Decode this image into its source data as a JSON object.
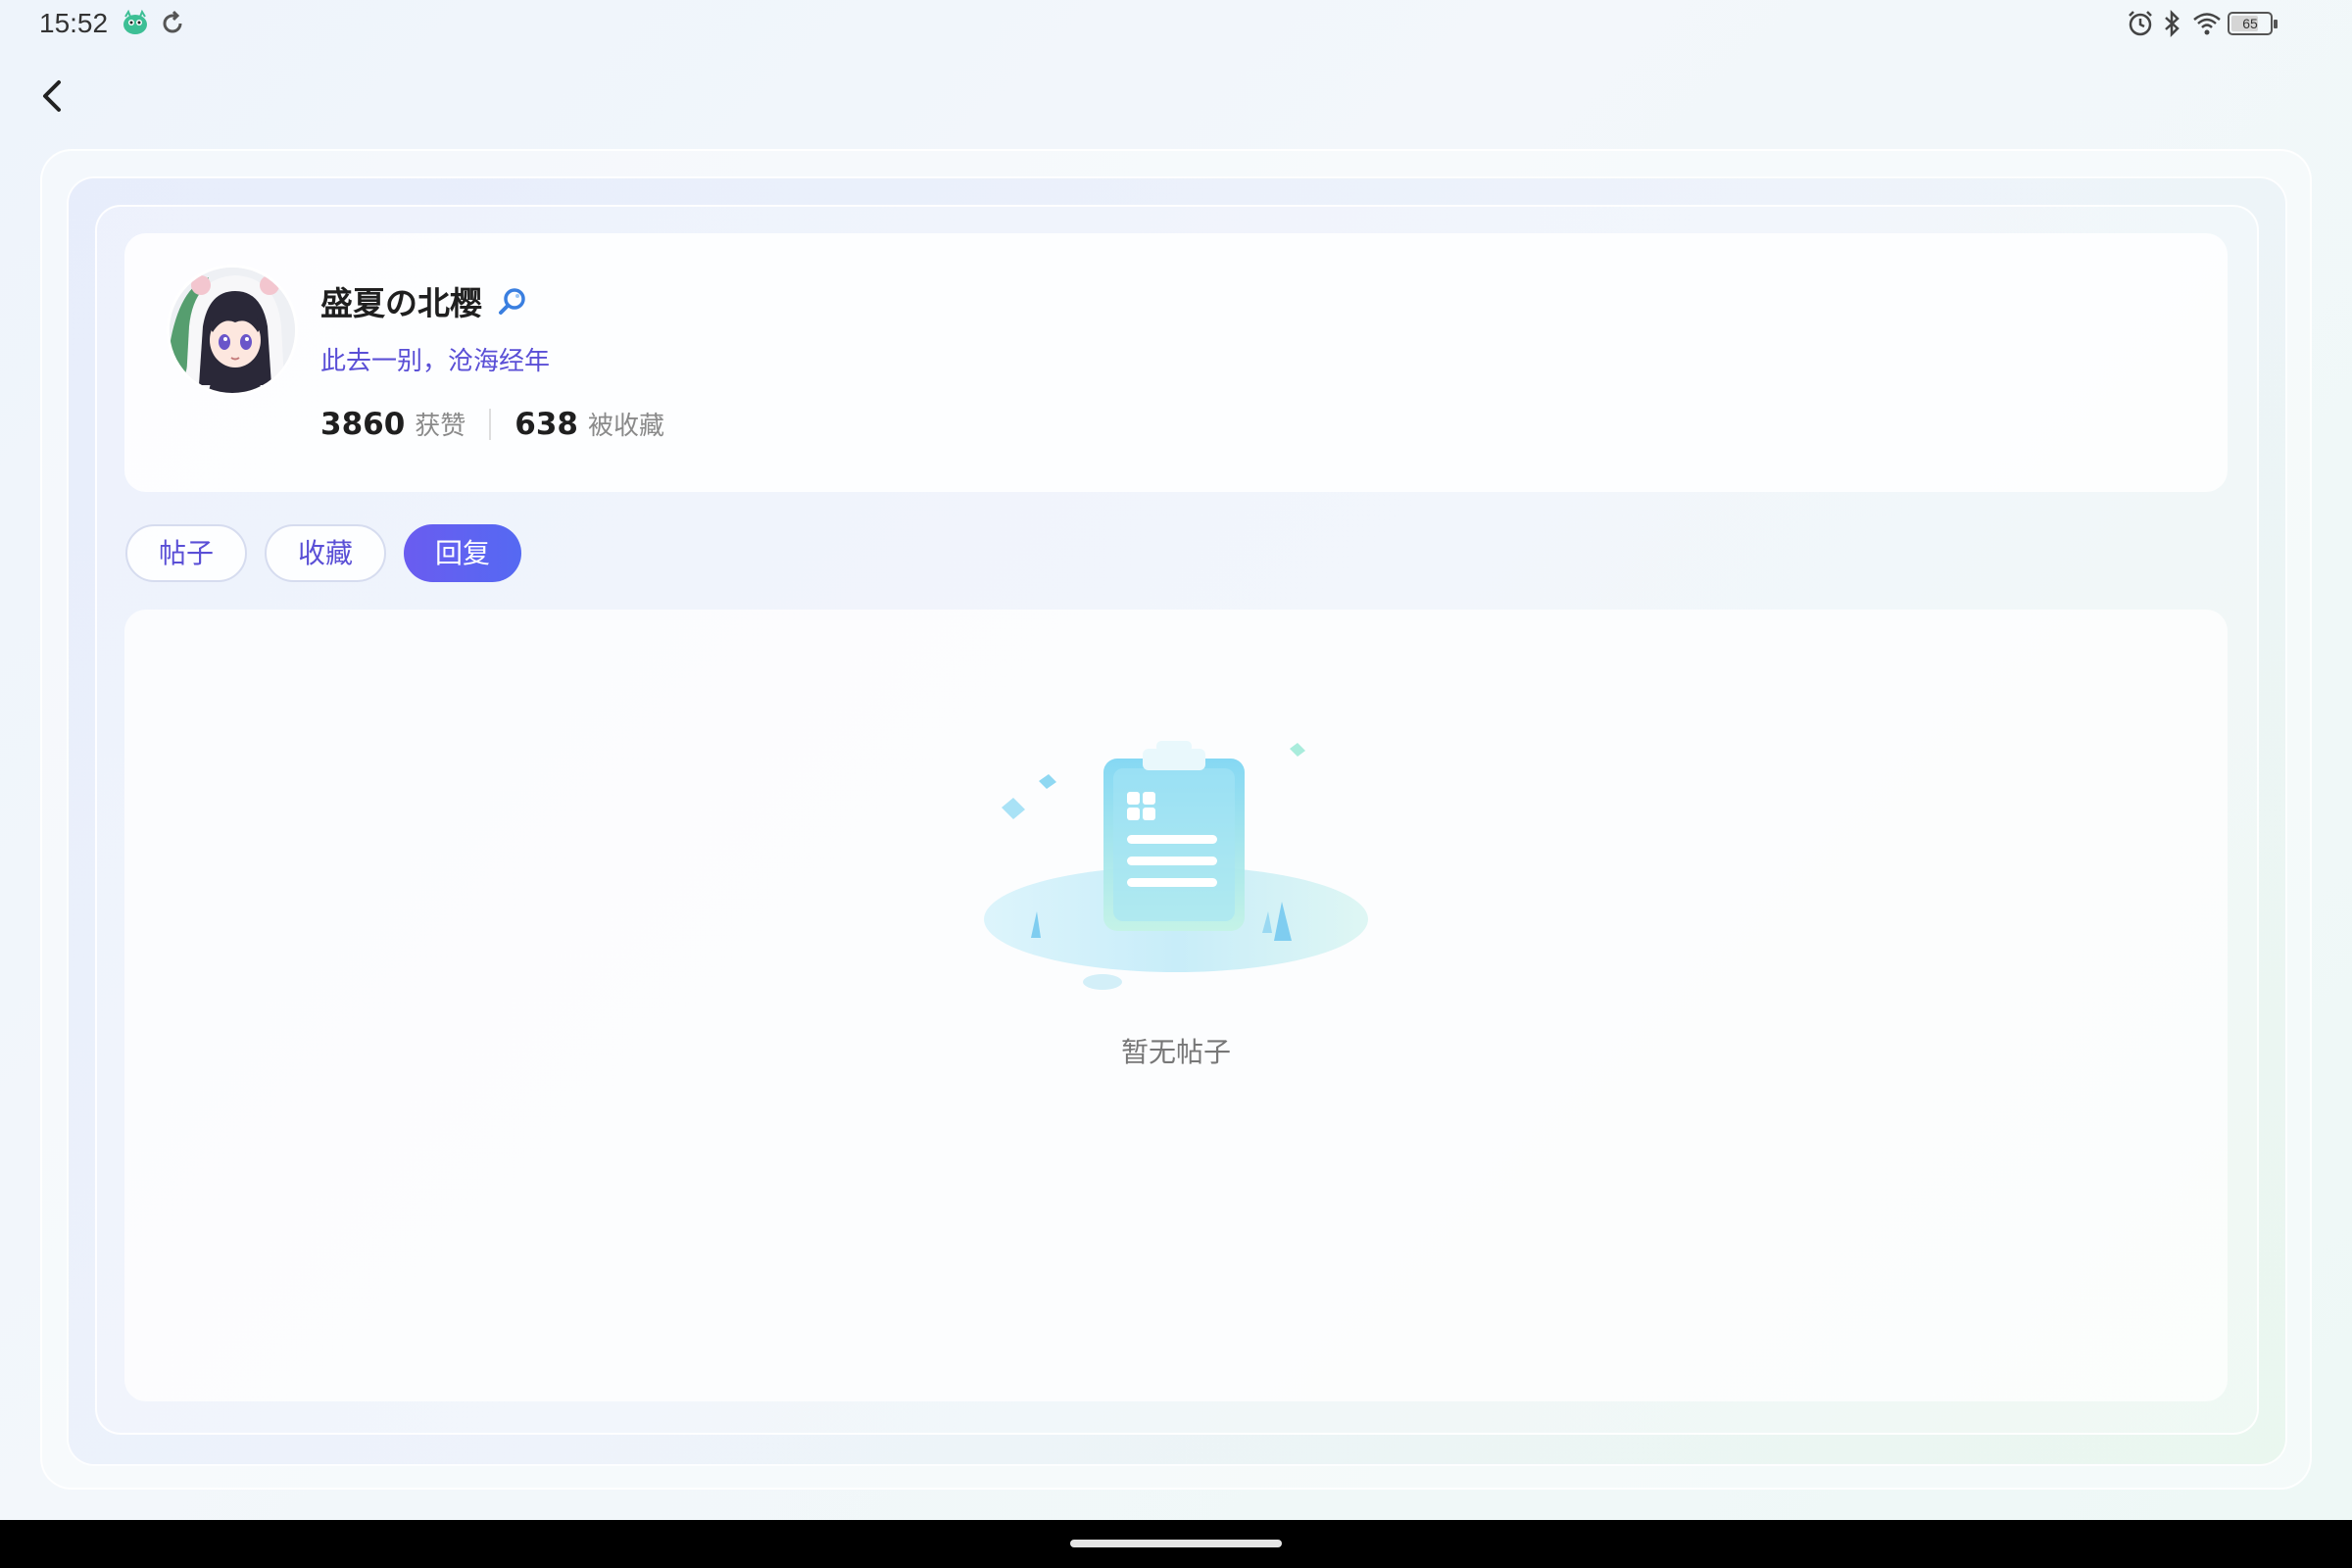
{
  "status_bar": {
    "time": "15:52",
    "battery_level": "65",
    "icons": [
      "app-notification-icon",
      "sync-icon",
      "alarm-icon",
      "bluetooth-icon",
      "wifi-icon",
      "battery-icon"
    ]
  },
  "navigation": {
    "back_icon": "chevron-left-icon"
  },
  "profile": {
    "username": "盛夏の北樱",
    "verify_icon": "search-badge-icon",
    "signature": "此去一别，沧海经年",
    "stats": [
      {
        "value": "3860",
        "label": "获赞"
      },
      {
        "value": "638",
        "label": "被收藏"
      }
    ]
  },
  "tabs": [
    {
      "label": "帖子",
      "active": false
    },
    {
      "label": "收藏",
      "active": false
    },
    {
      "label": "回复",
      "active": true
    }
  ],
  "empty_state": {
    "icon": "empty-clipboard-icon",
    "text": "暂无帖子"
  },
  "colors": {
    "accent": "#5a4fd6",
    "active_tab_start": "#6a5cf0",
    "active_tab_end": "#5569f2"
  }
}
